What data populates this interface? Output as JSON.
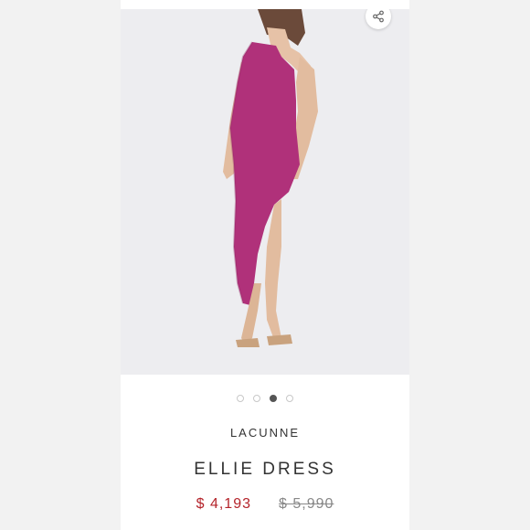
{
  "product": {
    "brand": "LACUNNE",
    "name": "ELLIE DRESS",
    "sale_price": "$ 4,193",
    "original_price": "$ 5,990",
    "dress_color": "#b0317a",
    "sale_color": "#b4232a"
  },
  "gallery": {
    "total_images": 4,
    "active_index": 2
  },
  "icons": {
    "share": "share-icon"
  }
}
